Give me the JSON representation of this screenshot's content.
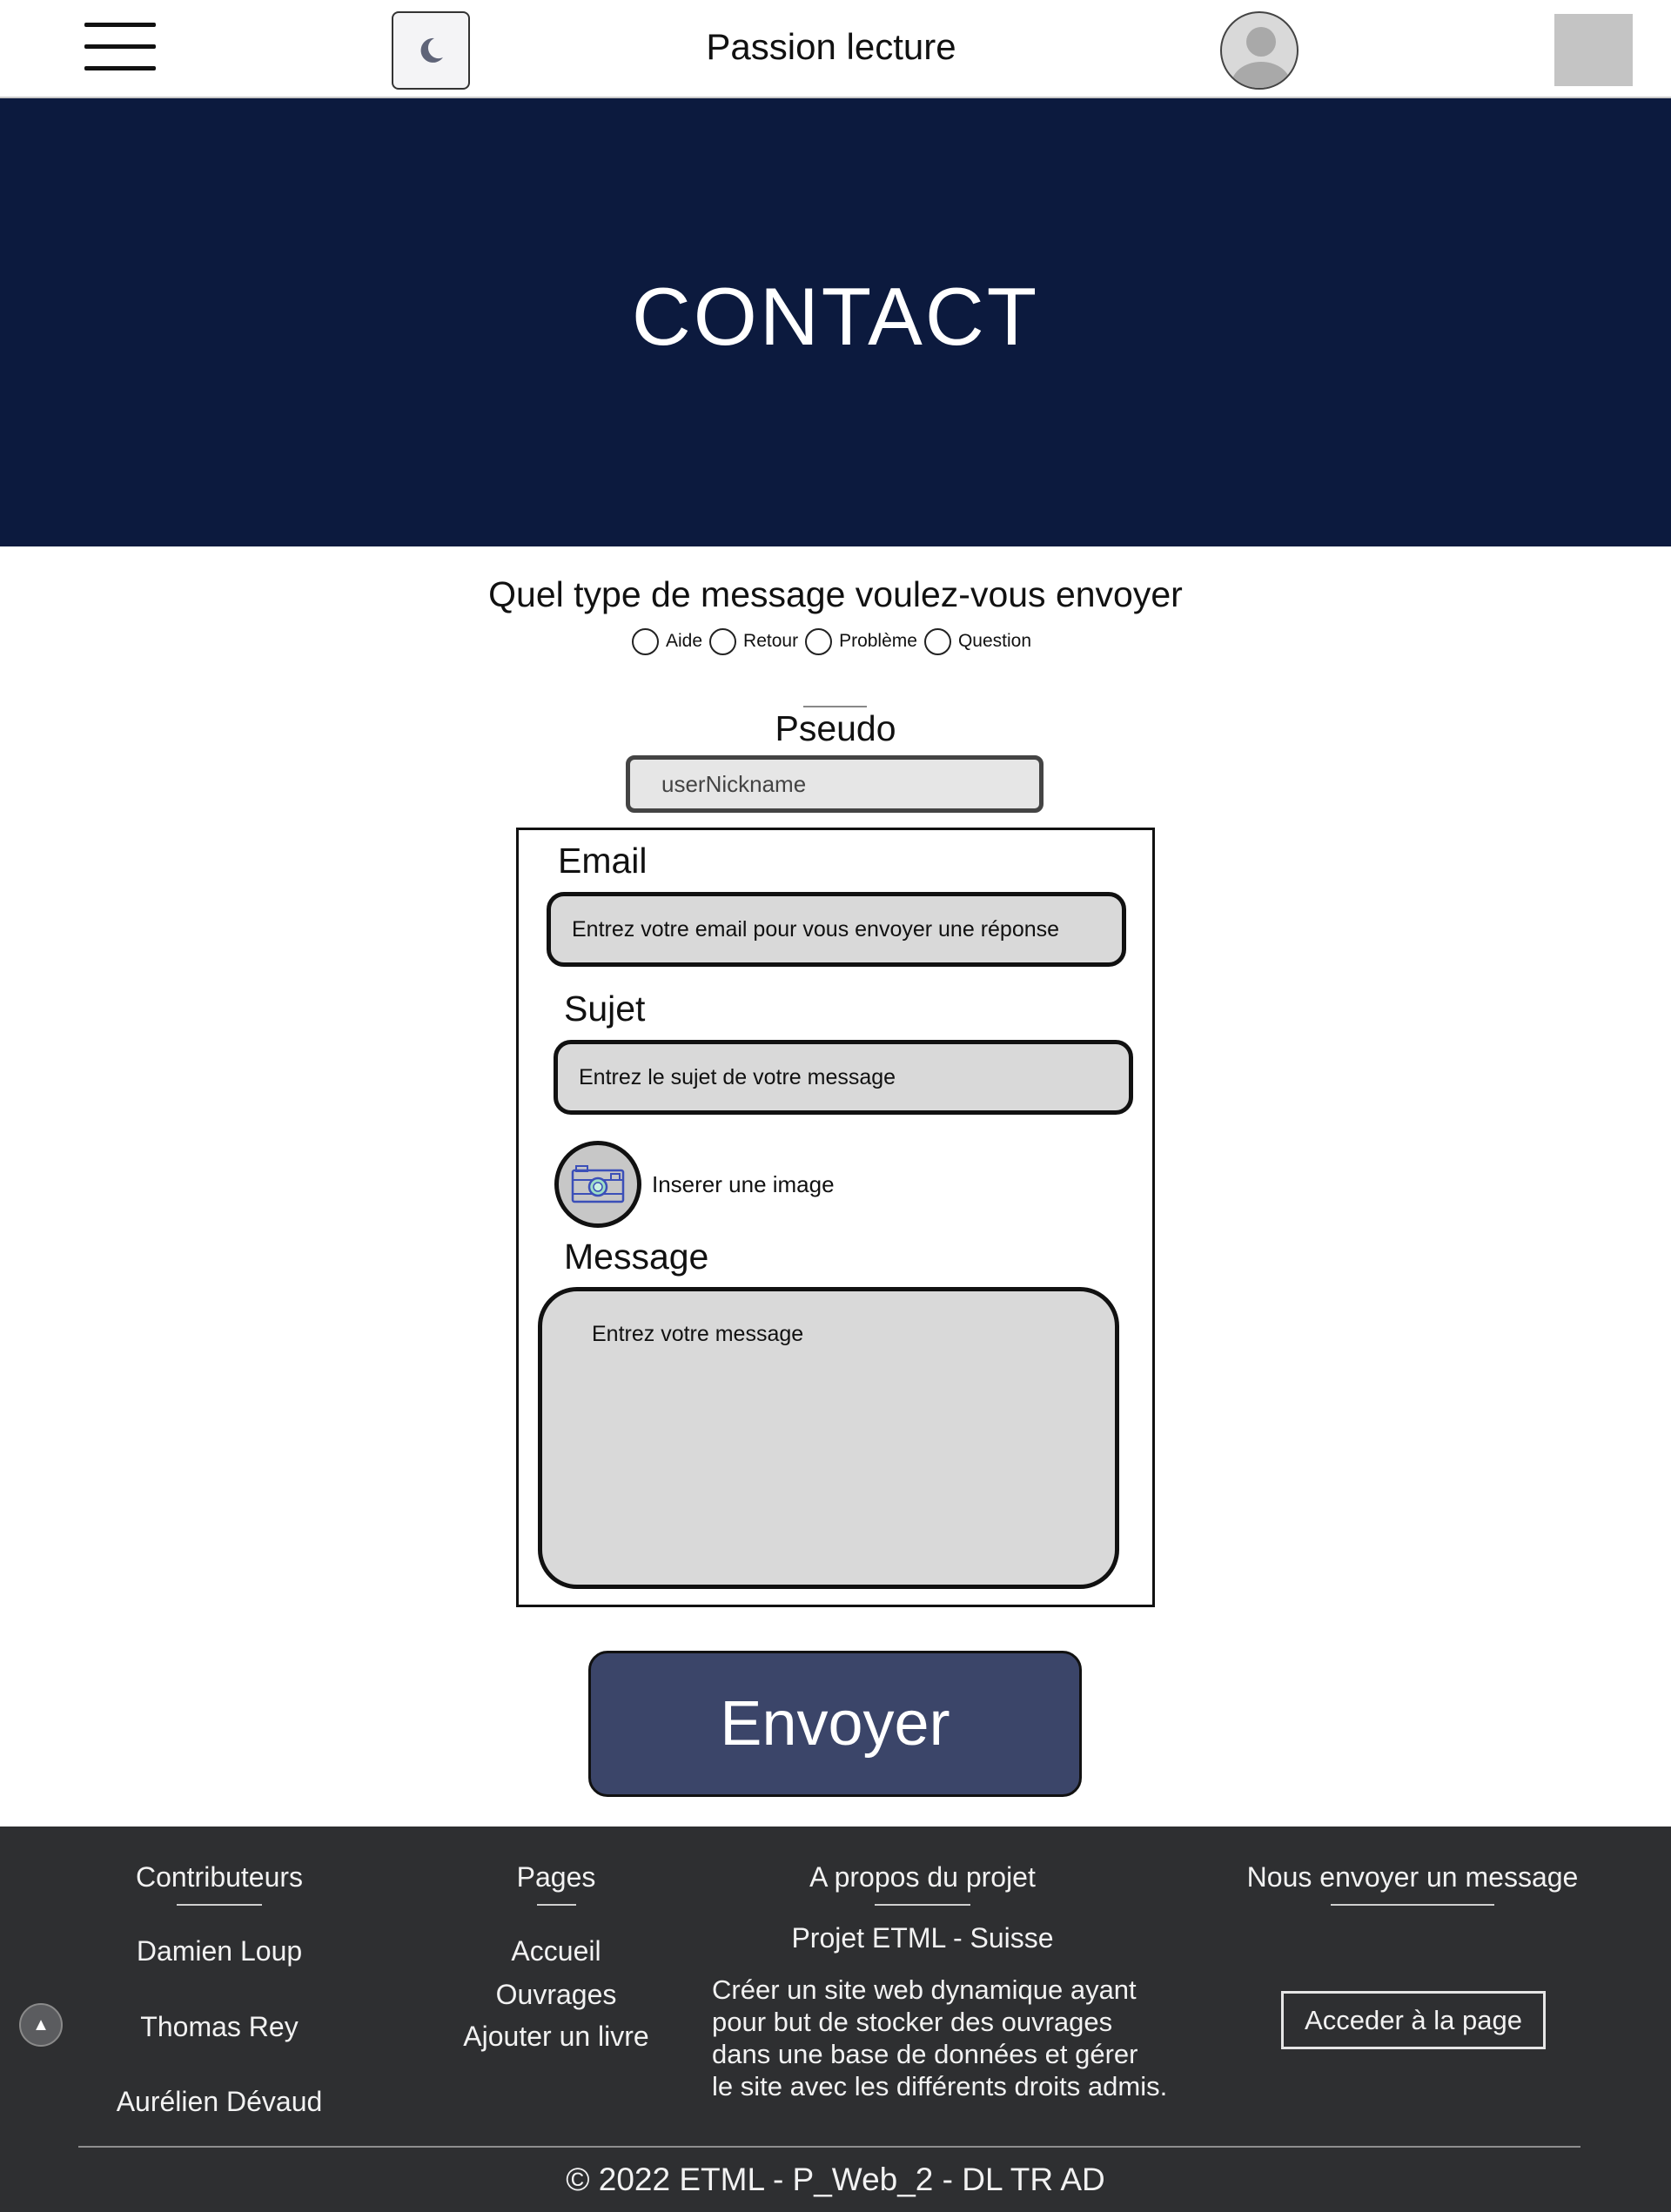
{
  "header": {
    "menu_icon": "hamburger-menu-icon",
    "theme_icon": "moon-icon",
    "site_title": "Passion lecture",
    "avatar_icon": "user-avatar-icon"
  },
  "hero": {
    "title": "CONTACT"
  },
  "message_type": {
    "question": "Quel type de message voulez-vous envoyer",
    "options": [
      "Aide",
      "Retour",
      "Problème",
      "Question"
    ]
  },
  "pseudo": {
    "label": "Pseudo",
    "value": "userNickname"
  },
  "form": {
    "email_label": "Email",
    "email_placeholder": "Entrez votre email pour vous envoyer une réponse",
    "subject_label": "Sujet",
    "subject_placeholder": "Entrez le sujet de votre message",
    "image_icon": "camera-icon",
    "image_label": "Inserer une image",
    "message_label": "Message",
    "message_placeholder": "Entrez votre message"
  },
  "send_button": "Envoyer",
  "footer": {
    "contributors": {
      "heading": "Contributeurs",
      "names": [
        "Damien Loup",
        "Thomas Rey",
        "Aurélien Dévaud"
      ]
    },
    "pages": {
      "heading": "Pages",
      "links": [
        "Accueil",
        "Ouvrages",
        "Ajouter un livre"
      ]
    },
    "about": {
      "heading": "A propos du projet",
      "subtitle": "Projet ETML - Suisse",
      "lines": [
        "Créer un site web dynamique ayant",
        "pour but de stocker des ouvrages",
        "dans une base de données et gérer",
        "le site avec les différents droits admis."
      ]
    },
    "contact": {
      "heading": "Nous envoyer un message",
      "button": "Acceder à la page"
    },
    "scroll_top_icon": "arrow-up-icon",
    "copyright": "© 2022 ETML - P_Web_2 - DL TR AD"
  },
  "colors": {
    "hero_bg": "#0c1a3e",
    "button_bg": "#3b4569",
    "footer_bg": "#2e2f31",
    "field_bg": "#d9d9d9"
  }
}
